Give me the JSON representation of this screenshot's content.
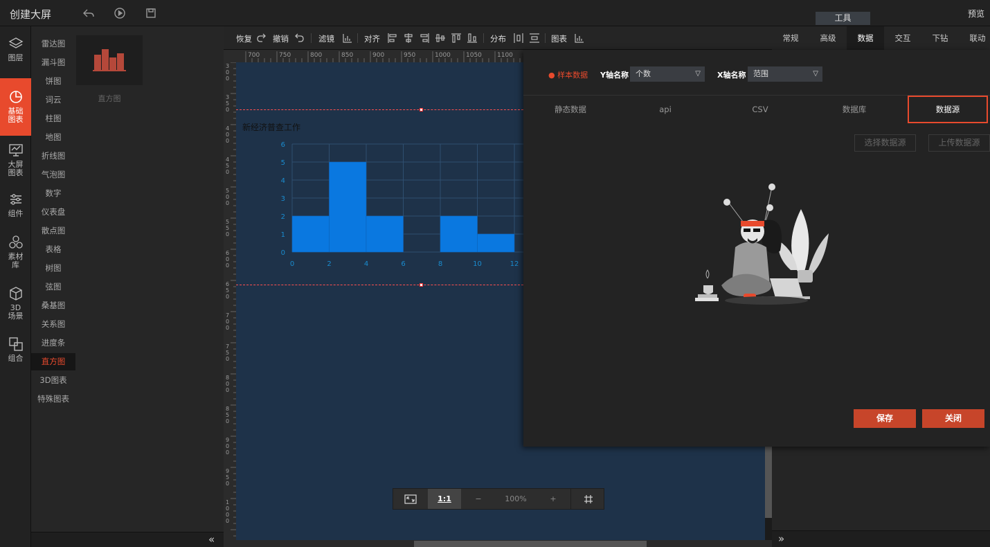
{
  "app": {
    "title": "创建大屏",
    "preview": "预览",
    "tools_tab": "工具"
  },
  "leftnav": [
    {
      "label": "图层",
      "icon": "layers-icon"
    },
    {
      "label": "基础图表",
      "icon": "pie-chart-icon",
      "active": true
    },
    {
      "label": "大屏图表",
      "icon": "monitor-chart-icon"
    },
    {
      "label": "组件",
      "icon": "sliders-icon"
    },
    {
      "label": "素材库",
      "icon": "hexagons-icon"
    },
    {
      "label": "3D场景",
      "icon": "cube-icon"
    },
    {
      "label": "组合",
      "icon": "combine-icon"
    }
  ],
  "chart_types": [
    "雷达图",
    "漏斗图",
    "饼图",
    "词云",
    "柱图",
    "地图",
    "折线图",
    "气泡图",
    "数字",
    "仪表盘",
    "散点图",
    "表格",
    "树图",
    "弦图",
    "桑基图",
    "关系图",
    "进度条",
    "直方图",
    "3D图表",
    "特殊图表"
  ],
  "active_chart_type": "直方图",
  "thumbnail": {
    "label": "直方图",
    "icon": "histogram-icon"
  },
  "toolbar": {
    "redo": "恢复",
    "undo": "撤销",
    "filter": "滤镜",
    "align": "对齐",
    "distribute": "分布",
    "chart": "图表"
  },
  "hruler_ticks": [
    "700",
    "750",
    "800",
    "850",
    "900",
    "950",
    "1000",
    "1050",
    "1100"
  ],
  "vruler_ticks": [
    "300",
    "350",
    "400",
    "450",
    "500",
    "550",
    "600",
    "650",
    "700",
    "750",
    "800",
    "850",
    "900",
    "950",
    "1000"
  ],
  "canvas_chart": {
    "title": "新经济普查工作"
  },
  "chart_data": {
    "type": "bar",
    "title": "新经济普查工作",
    "x": [
      0,
      2,
      4,
      6,
      8,
      10,
      12
    ],
    "bins": [
      [
        0,
        2
      ],
      [
        2,
        4
      ],
      [
        4,
        6
      ],
      [
        6,
        8
      ],
      [
        8,
        10
      ],
      [
        10,
        12
      ]
    ],
    "values": [
      2,
      5,
      2,
      0,
      2,
      1
    ],
    "yticks": [
      0,
      1,
      2,
      3,
      4,
      5,
      6
    ],
    "xticks": [
      0,
      2,
      4,
      6,
      8,
      10,
      12
    ],
    "ylim": [
      0,
      6
    ],
    "xlim": [
      0,
      14
    ],
    "grid": true,
    "bar_color": "#0a78e0"
  },
  "zoom": {
    "fit_icon": "fit-screen-icon",
    "ratio_label": "1:1",
    "minus": "−",
    "value": "100%",
    "plus": "+",
    "grid_icon": "grid-icon"
  },
  "right_tabs": [
    "常规",
    "高级",
    "数据",
    "交互",
    "下钻",
    "联动"
  ],
  "right_active_tab": "数据",
  "dialog": {
    "sample_label": "● 样本数据",
    "y_name_label": "Y轴名称",
    "y_name_value": "个数",
    "x_name_label": "X轴名称",
    "x_name_value": "范围",
    "source_tabs": [
      "静态数据",
      "api",
      "CSV",
      "数据库",
      "数据源"
    ],
    "active_source_tab": "数据源",
    "select_source": "选择数据源",
    "upload_source": "上传数据源",
    "save": "保存",
    "close": "关闭"
  },
  "colors": {
    "accent": "#e84a2d",
    "canvas": "#1e3249",
    "bar": "#0a78e0"
  }
}
